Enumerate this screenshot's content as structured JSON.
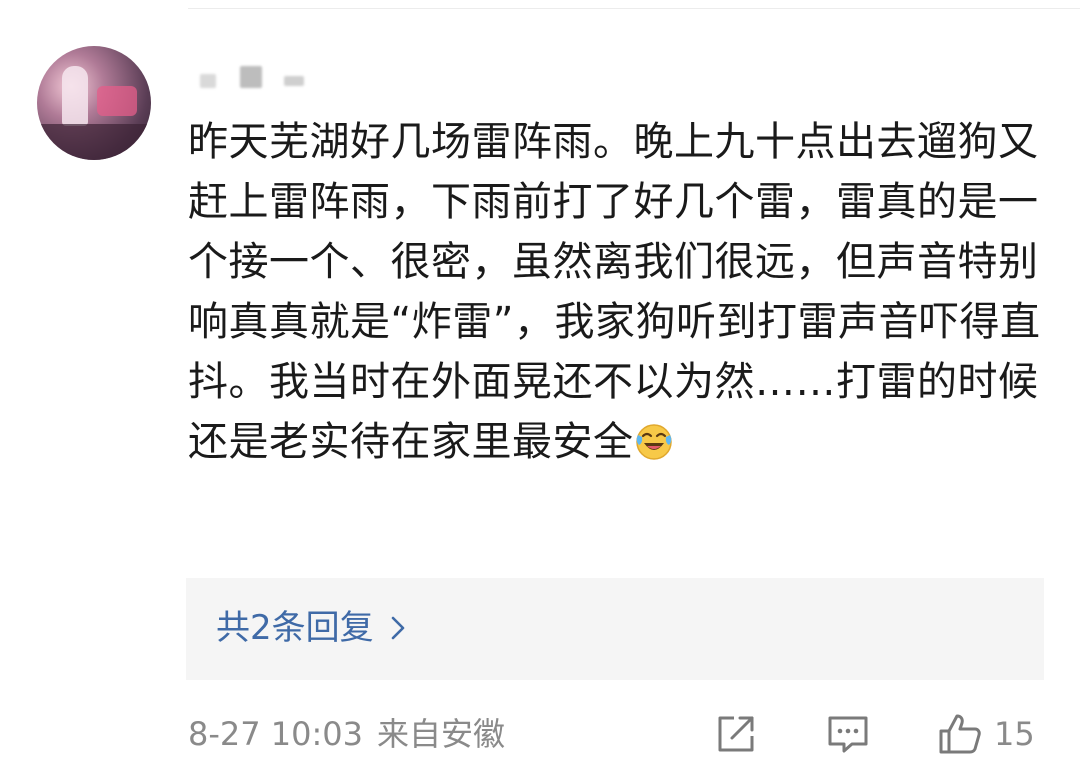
{
  "comment": {
    "text": "昨天芜湖好几场雷阵雨。晚上九十点出去遛狗又赶上雷阵雨，下雨前打了好几个雷，雷真的是一个接一个、很密，虽然离我们很远，但声音特别响真真就是“炸雷”，我家狗听到打雷声音吓得直抖。我当时在外面晃还不以为然……打雷的时候还是老实待在家里最安全",
    "emoji": "laugh-cry-emoji"
  },
  "replies": {
    "label": "共2条回复"
  },
  "footer": {
    "time": "8-27 10:03",
    "source": "来自安徽",
    "likes": "15"
  },
  "colors": {
    "reply_link": "#3f6aa7",
    "meta_gray": "#8a8a8a",
    "reply_bg": "#f5f5f5"
  },
  "icons": {
    "share": "share-icon",
    "comment": "comment-icon",
    "like": "thumbs-up-icon",
    "chevron": "chevron-right-icon"
  }
}
